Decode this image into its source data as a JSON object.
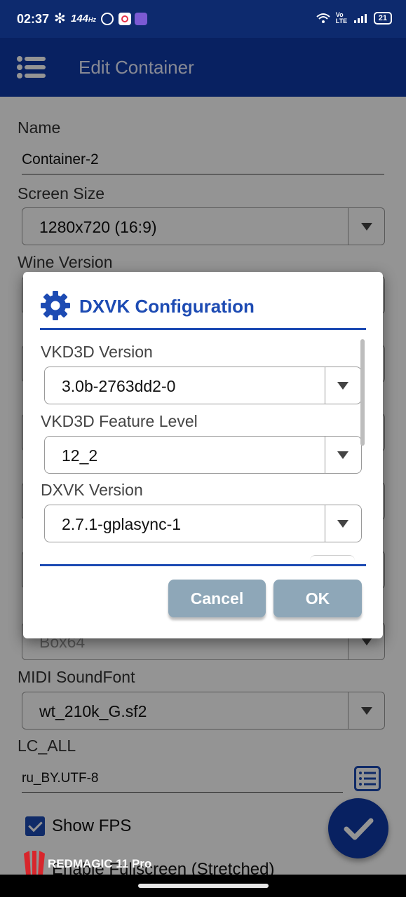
{
  "status_bar": {
    "time": "02:37",
    "refresh_rate": "144",
    "refresh_unit": "Hz",
    "network": "Vo LTE",
    "battery": "21"
  },
  "app_bar": {
    "title": "Edit Container",
    "menu_icon": "menu-icon"
  },
  "form": {
    "name_label": "Name",
    "name_value": "Container-2",
    "screen_size_label": "Screen Size",
    "screen_size_value": "1280x720 (16:9)",
    "wine_version_label": "Wine Version",
    "box64_value": "Box64",
    "midi_label": "MIDI SoundFont",
    "midi_value": "wt_210k_G.sf2",
    "lc_all_label": "LC_ALL",
    "lc_all_value": "ru_BY.UTF-8",
    "show_fps_label": "Show FPS",
    "fullscreen_label": "Enable Fullscreen (Stretched)"
  },
  "dialog": {
    "title": "DXVK Configuration",
    "icon": "gear-icon",
    "vkd3d_version_label": "VKD3D Version",
    "vkd3d_version_value": "3.0b-2763dd2-0",
    "vkd3d_feature_label": "VKD3D Feature Level",
    "vkd3d_feature_value": "12_2",
    "dxvk_version_label": "DXVK Version",
    "dxvk_version_value": "2.7.1-gplasync-1",
    "cancel_label": "Cancel",
    "ok_label": "OK"
  },
  "device_overlay": {
    "brand_text": "REDMAGIC 11 Pro"
  },
  "colors": {
    "status_bar": "#0d2a6e",
    "app_bar": "#0f3aa8",
    "accent": "#1d4bb3",
    "dialog_button": "#8ea7b8"
  }
}
